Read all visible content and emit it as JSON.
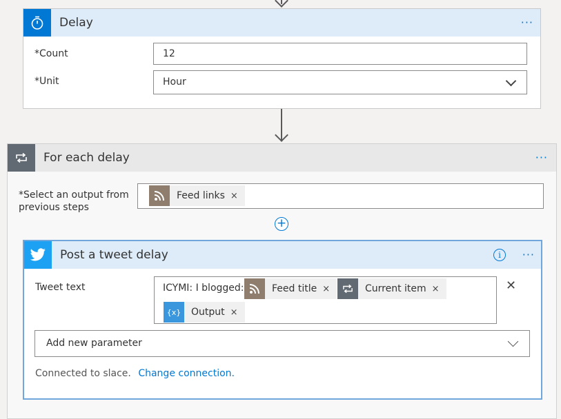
{
  "delay": {
    "title": "Delay",
    "menu": "···",
    "count_label": "Count",
    "count_value": "12",
    "unit_label": "Unit",
    "unit_value": "Hour",
    "required_mark": "*"
  },
  "foreach": {
    "title": "For each delay",
    "menu": "···",
    "select_label_line1": "*Select an output from",
    "select_label_line2": "previous steps",
    "token_label": "Feed links",
    "remove": "×",
    "add_symbol": "+"
  },
  "tweet": {
    "title": "Post a tweet delay",
    "info": "i",
    "menu": "···",
    "tweet_text_label": "Tweet text",
    "prefix_text": "ICYMI: I blogged:",
    "tokens": [
      "Feed title",
      "Current item",
      "Output"
    ],
    "remove": "×",
    "clear": "✕",
    "add_param": "Add new parameter",
    "connected_text": "Connected to slace.",
    "change_connection": "Change connection."
  },
  "colors": {
    "accent": "#0078d4",
    "header_bg": "#deecf9",
    "loop_gray": "#616a73",
    "rss": "#8f7e6e",
    "twitter": "#1da1f2"
  },
  "icons": {
    "delay": "timer-icon",
    "foreach": "loop-icon",
    "tweet": "twitter-bird-icon",
    "feed": "rss-icon",
    "variable": "variable-icon"
  }
}
